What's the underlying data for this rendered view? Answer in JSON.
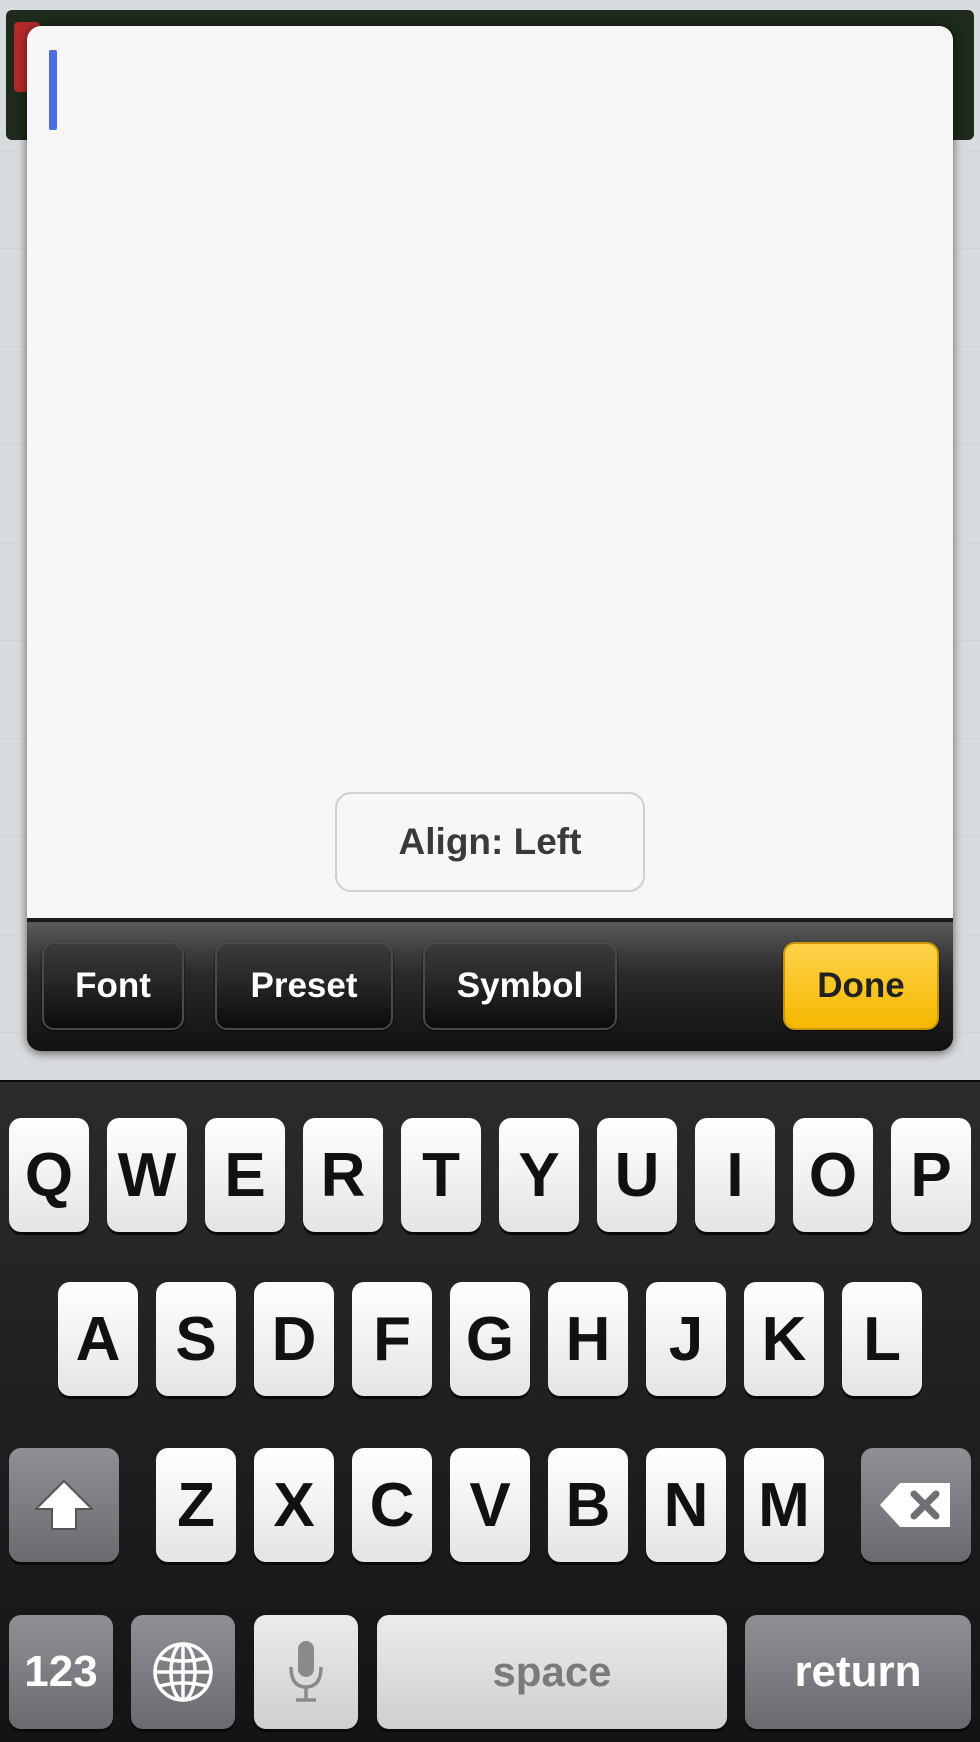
{
  "editor": {
    "align_label": "Align: Left"
  },
  "toolbar": {
    "font_label": "Font",
    "preset_label": "Preset",
    "symbol_label": "Symbol",
    "done_label": "Done"
  },
  "keyboard": {
    "row1": [
      "Q",
      "W",
      "E",
      "R",
      "T",
      "Y",
      "U",
      "I",
      "O",
      "P"
    ],
    "row2": [
      "A",
      "S",
      "D",
      "F",
      "G",
      "H",
      "J",
      "K",
      "L"
    ],
    "row3": [
      "Z",
      "X",
      "C",
      "V",
      "B",
      "N",
      "M"
    ],
    "numbers_label": "123",
    "space_label": "space",
    "return_label": "return"
  },
  "colors": {
    "cursor": "#4a6ee0",
    "done_button": "#f5b800"
  },
  "icons": [
    "shift-icon",
    "delete-icon",
    "globe-icon",
    "microphone-icon"
  ]
}
